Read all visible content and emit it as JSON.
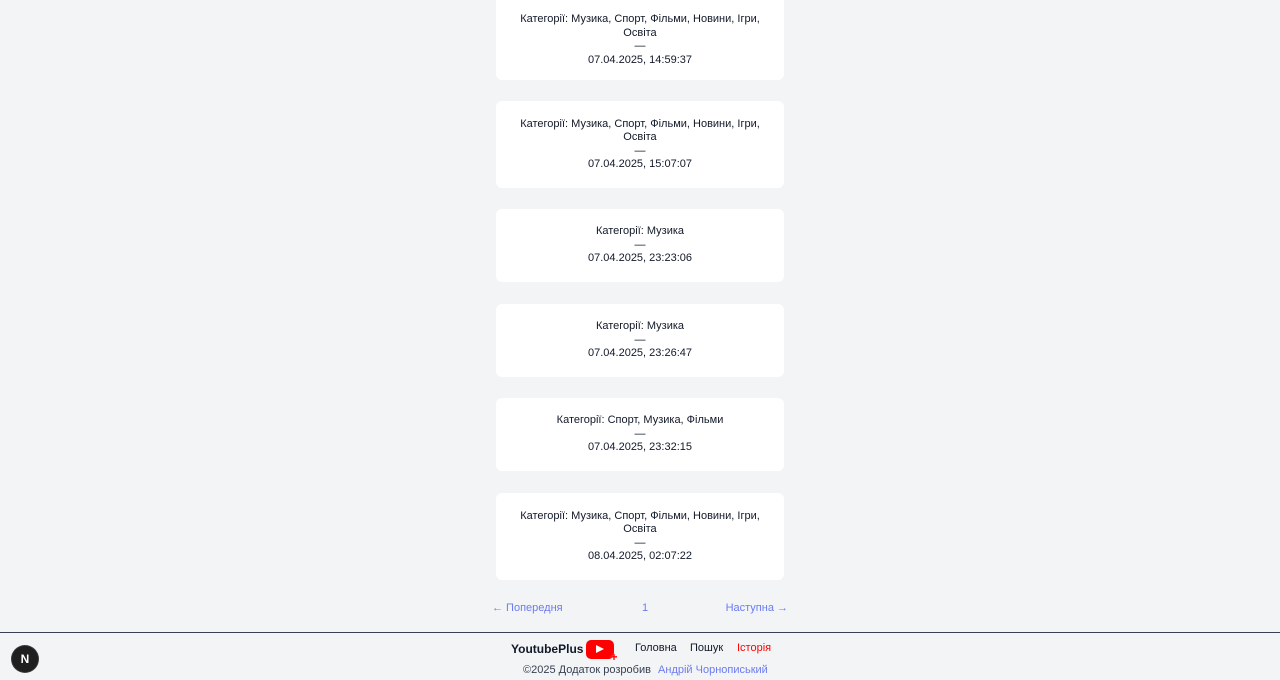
{
  "history": {
    "items": [
      {
        "categories": "Категорії: Музика, Спорт, Фільми, Новини, Ігри, Освіта",
        "dash": "—",
        "date": "07.04.2025, 14:59:37"
      },
      {
        "categories": "Категорії: Музика, Спорт, Фільми, Новини, Ігри, Освіта",
        "dash": "—",
        "date": "07.04.2025, 15:07:07"
      },
      {
        "categories": "Категорії: Музика",
        "dash": "—",
        "date": "07.04.2025, 23:23:06"
      },
      {
        "categories": "Категорії: Музика",
        "dash": "—",
        "date": "07.04.2025, 23:26:47"
      },
      {
        "categories": "Категорії: Спорт, Музика, Фільми",
        "dash": "—",
        "date": "07.04.2025, 23:32:15"
      },
      {
        "categories": "Категорії: Музика, Спорт, Фільми, Новини, Ігри, Освіта",
        "dash": "—",
        "date": "08.04.2025, 02:07:22"
      }
    ]
  },
  "pagination": {
    "prev_label": "← Попередня",
    "current_page": "1",
    "next_label": "Наступна →"
  },
  "footer": {
    "brand": "YoutubePlus",
    "brand_plus": "+",
    "nav": {
      "home": "Головна",
      "search": "Пошук",
      "history": "Історія"
    },
    "copyright": "©2025 Додаток розробив",
    "author": "Андрій Чорнописький"
  },
  "dev_badge": {
    "letter": "N"
  },
  "colors": {
    "accent_link": "#6b7cf0",
    "active_nav": "#ff0000",
    "brand_red": "#ff0000",
    "background": "#f3f4f6"
  }
}
